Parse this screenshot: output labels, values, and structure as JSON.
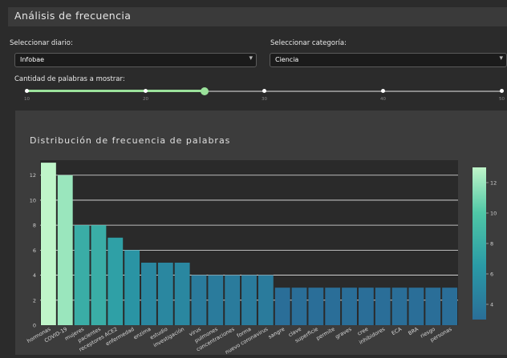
{
  "app": {
    "title": "Análisis de frecuencia"
  },
  "controls": {
    "newspaper_label": "Seleccionar diario:",
    "newspaper_value": "Infobae",
    "category_label": "Seleccionar categoría:",
    "category_value": "Ciencia",
    "words_label": "Cantidad de palabras a mostrar:",
    "slider": {
      "min": 10,
      "max": 50,
      "value": 25,
      "ticks": [
        "10",
        "20",
        "30",
        "40",
        "50"
      ]
    }
  },
  "chart_data": {
    "type": "bar",
    "title": "Distribución de frecuencia de palabras",
    "xlabel": "",
    "ylabel": "",
    "ylim": [
      0,
      13.2
    ],
    "yticks": [
      "0",
      "2",
      "4",
      "6",
      "8",
      "10",
      "12"
    ],
    "categories": [
      "hormonas",
      "COVID-19",
      "mujeres",
      "pacientes",
      "receptores ACE2",
      "enfermedad",
      "enzima",
      "estudio",
      "investigación",
      "virus",
      "pulmones",
      "concentraciones",
      "forma",
      "nuevo coronavirus",
      "sangre",
      "clave",
      "superficie",
      "permite",
      "graves",
      "cree",
      "inhibidores",
      "ECA",
      "BRA",
      "riesgo",
      "personas"
    ],
    "values": [
      13,
      12,
      8,
      8,
      7,
      6,
      5,
      5,
      5,
      4,
      4,
      4,
      4,
      4,
      3,
      3,
      3,
      3,
      3,
      3,
      3,
      3,
      3,
      3,
      3
    ],
    "colorbar": {
      "ticks": [
        "4",
        "6",
        "8",
        "10",
        "12"
      ]
    },
    "colors": {
      "low": "#2f7fa0",
      "mid": "#2fb0a0",
      "high": "#b6f2c4"
    }
  }
}
